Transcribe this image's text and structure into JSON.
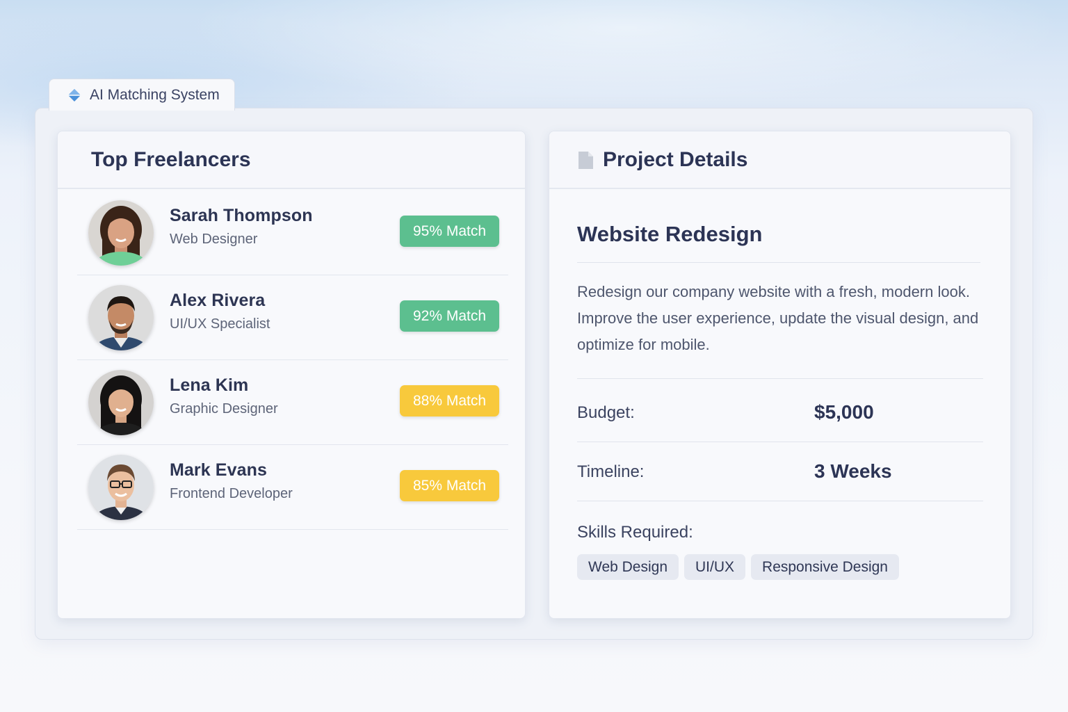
{
  "app": {
    "tab_label": "AI Matching System",
    "tab_icon": "diamond-icon",
    "accent": "#4a90d9"
  },
  "freelancers_panel": {
    "title": "Top Freelancers",
    "items": [
      {
        "name": "Sarah Thompson",
        "role": "Web Designer",
        "match": "95%",
        "match_suffix": "Match",
        "badge_color": "#5cbf8f"
      },
      {
        "name": "Alex Rivera",
        "role": "UI/UX Specialist",
        "match": "92%",
        "match_suffix": "Match",
        "badge_color": "#5cbf8f"
      },
      {
        "name": "Lena Kim",
        "role": "Graphic Designer",
        "match": "88%",
        "match_suffix": "Match",
        "badge_color": "#f8c93c"
      },
      {
        "name": "Mark Evans",
        "role": "Frontend Developer",
        "match": "85%",
        "match_suffix": "Match",
        "badge_color": "#f8c93c"
      }
    ]
  },
  "project_panel": {
    "title": "Project Details",
    "icon": "document-icon",
    "project_name": "Website Redesign",
    "description": "Redesign our company website with a fresh, modern look. Improve the user experience, update the visual design, and optimize for mobile.",
    "budget_label": "Budget:",
    "budget_value": "$5,000",
    "timeline_label": "Timeline:",
    "timeline_value": "3 Weeks",
    "skills_label": "Skills Required:",
    "skills": [
      "Web Design",
      "UI/UX",
      "Responsive Design"
    ]
  }
}
